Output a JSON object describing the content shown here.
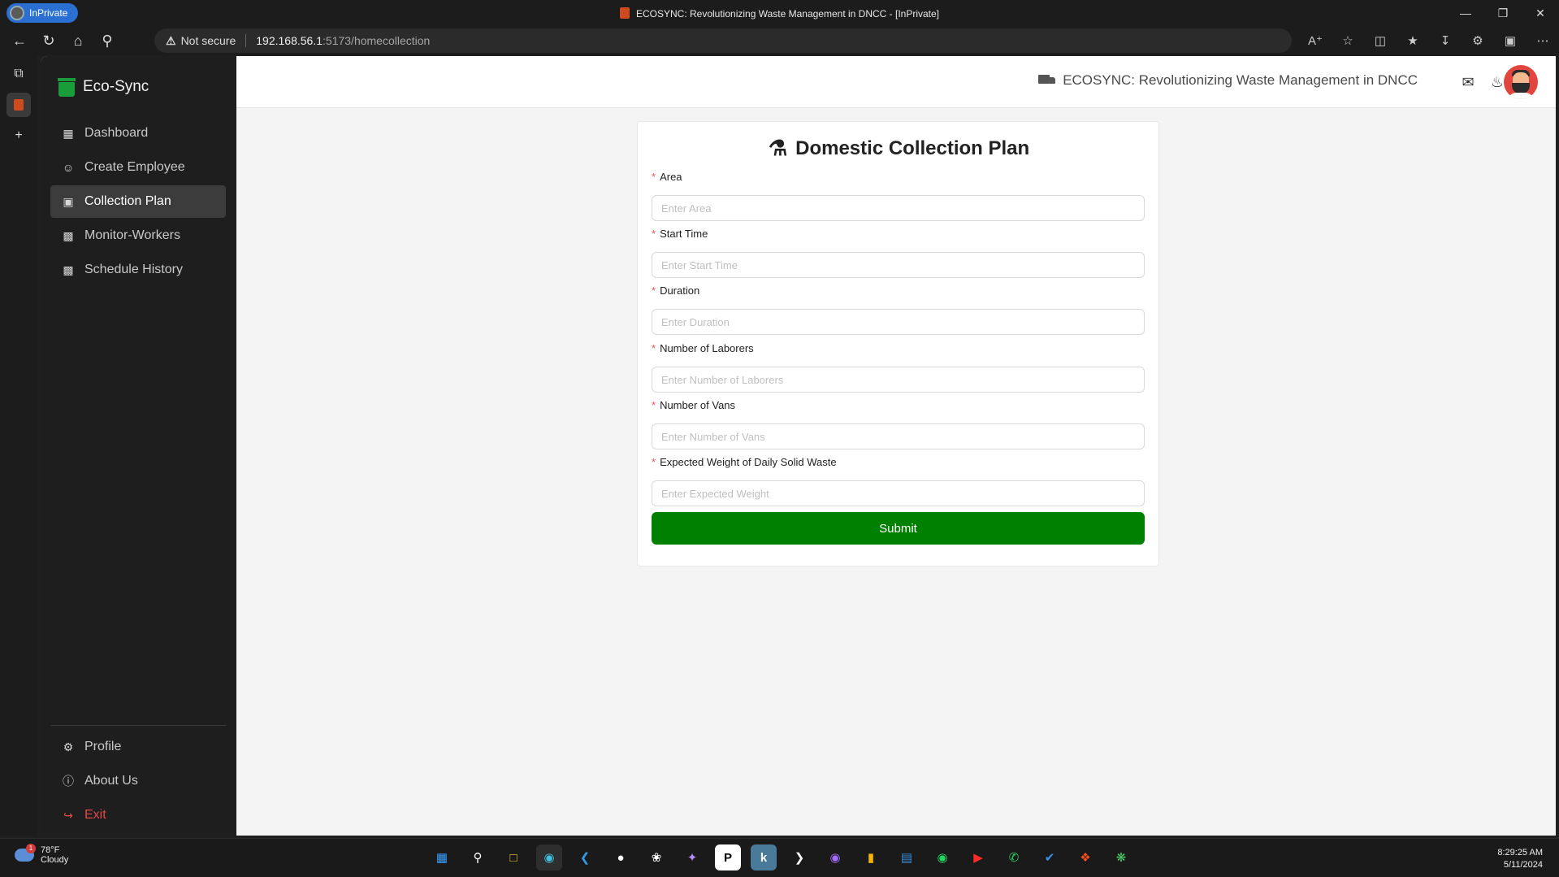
{
  "browser": {
    "inprivate_label": "InPrivate",
    "window_title": "ECOSYNC: Revolutionizing Waste Management in DNCC - [InPrivate]",
    "security_label": "Not secure",
    "url_host": "192.168.56.1",
    "url_path": ":5173/homecollection"
  },
  "sidebar": {
    "brand": "Eco-Sync",
    "items": [
      {
        "label": "Dashboard",
        "icon": "grid-icon"
      },
      {
        "label": "Create Employee",
        "icon": "users-icon"
      },
      {
        "label": "Collection Plan",
        "icon": "gallery-icon",
        "active": true
      },
      {
        "label": "Monitor-Workers",
        "icon": "chart-icon"
      },
      {
        "label": "Schedule History",
        "icon": "chart-icon"
      }
    ],
    "bottom_items": [
      {
        "label": "Profile",
        "icon": "gear-icon"
      },
      {
        "label": "About Us",
        "icon": "question-icon"
      },
      {
        "label": "Exit",
        "icon": "logout-icon"
      }
    ]
  },
  "header": {
    "title": "ECOSYNC: Revolutionizing Waste Management in DNCC"
  },
  "form": {
    "title": "Domestic Collection Plan",
    "fields": [
      {
        "label": "Area",
        "placeholder": "Enter Area",
        "value": ""
      },
      {
        "label": "Start Time",
        "placeholder": "Enter Start Time",
        "value": ""
      },
      {
        "label": "Duration",
        "placeholder": "Enter Duration",
        "value": ""
      },
      {
        "label": "Number of Laborers",
        "placeholder": "Enter Number of Laborers",
        "value": ""
      },
      {
        "label": "Number of Vans",
        "placeholder": "Enter Number of Vans",
        "value": ""
      },
      {
        "label": "Expected Weight of Daily Solid Waste",
        "placeholder": "Enter Expected Weight",
        "value": ""
      }
    ],
    "submit_label": "Submit",
    "required_mark": "*"
  },
  "taskbar": {
    "weather_temp": "78°F",
    "weather_desc": "Cloudy",
    "weather_badge": "1",
    "time": "8:29:25 AM",
    "date": "5/11/2024"
  },
  "colors": {
    "accent_green": "#008000",
    "brand_green": "#1a9c3a",
    "exit_red": "#e24a4a",
    "required_red": "#ff4d4f"
  }
}
